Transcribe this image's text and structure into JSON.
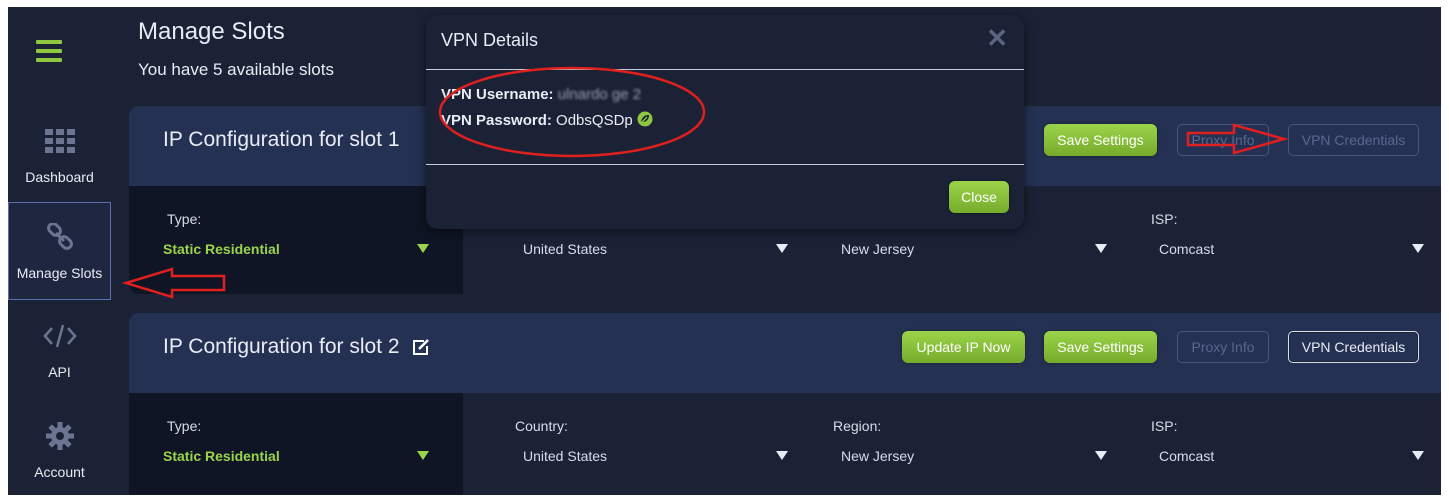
{
  "sidebar": {
    "items": [
      {
        "label": "Dashboard",
        "icon": "grid-icon"
      },
      {
        "label": "Manage Slots",
        "icon": "link-icon"
      },
      {
        "label": "API",
        "icon": "code-icon"
      },
      {
        "label": "Account",
        "icon": "gear-icon"
      }
    ]
  },
  "page": {
    "title": "Manage Slots",
    "subtitle": "You have 5 available slots"
  },
  "slots": [
    {
      "title": "IP Configuration for slot 1",
      "save_label": "Save Settings",
      "proxy_label": "Proxy Info",
      "vpn_label": "VPN Credentials",
      "type_label": "Type:",
      "type_value": "Static Residential",
      "country_value": "United States",
      "region_value": "New Jersey",
      "isp_label": "ISP:",
      "isp_value": "Comcast"
    },
    {
      "title": "IP Configuration for slot 2",
      "update_label": "Update IP Now",
      "save_label": "Save Settings",
      "proxy_label": "Proxy Info",
      "vpn_label": "VPN Credentials",
      "type_label": "Type:",
      "type_value": "Static Residential",
      "country_label": "Country:",
      "country_value": "United States",
      "region_label": "Region:",
      "region_value": "New Jersey",
      "isp_label": "ISP:",
      "isp_value": "Comcast"
    }
  ],
  "modal": {
    "title": "VPN Details",
    "username_label": "VPN Username:",
    "username_value": "ulnardo ge 2",
    "password_label": "VPN Password:",
    "password_value": "OdbsQSDp",
    "close_label": "Close"
  },
  "colors": {
    "accent_green": "#8ec63f",
    "background": "#1b2236",
    "card_header": "#253152",
    "annotation_red": "#e0201e"
  }
}
